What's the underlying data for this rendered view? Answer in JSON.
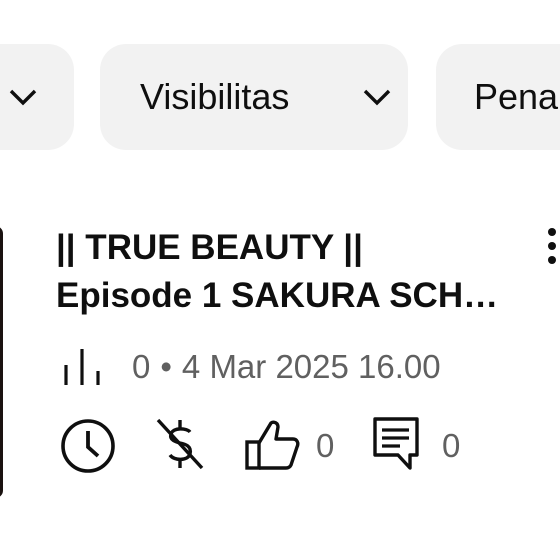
{
  "filters": {
    "visibility_label": "Visibilitas",
    "next_label": "Pena"
  },
  "video": {
    "title_line1": "|| TRUE BEAUTY ||",
    "title_line2": "Episode 1 SAKURA SCH…",
    "views": "0",
    "separator": "•",
    "date": "4 Mar 2025 16.00",
    "likes": "0",
    "comments": "0"
  },
  "icons": {
    "filter_chevron": "chevron-down-icon",
    "views": "bar-chart-icon",
    "visibility": "clock-icon",
    "monetization": "dollar-off-icon",
    "likes": "thumbs-up-icon",
    "comments": "comment-icon",
    "menu": "more-vert-icon"
  }
}
